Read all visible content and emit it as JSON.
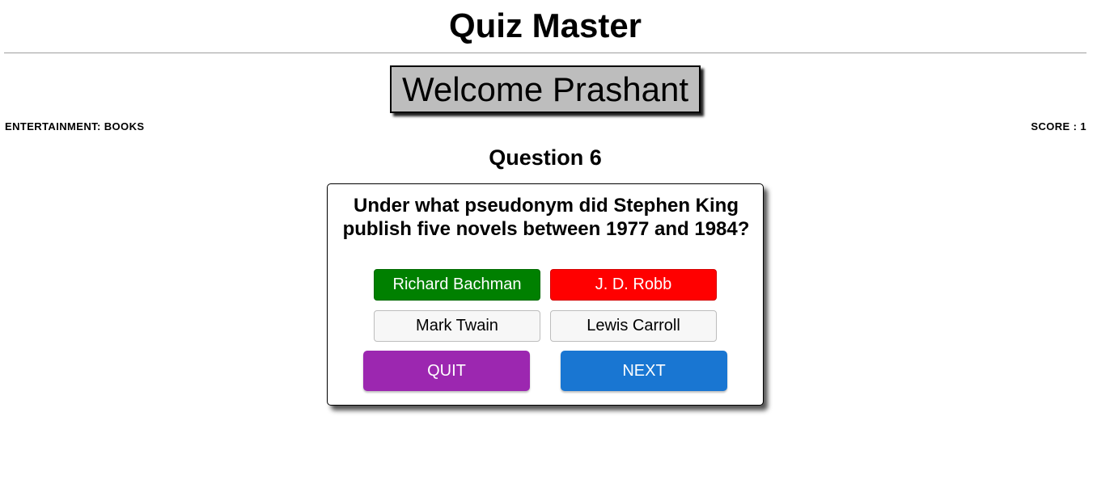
{
  "header": {
    "title": "Quiz Master"
  },
  "welcome": {
    "text": "Welcome Prashant"
  },
  "status": {
    "category": "ENTERTAINMENT: BOOKS",
    "score": "SCORE : 1"
  },
  "question": {
    "number_label": "Question 6",
    "text": "Under what pseudonym did Stephen King publish five novels between 1977 and 1984?",
    "answers": [
      {
        "label": "Richard Bachman",
        "state": "correct"
      },
      {
        "label": "J. D. Robb",
        "state": "wrong"
      },
      {
        "label": "Mark Twain",
        "state": "neutral"
      },
      {
        "label": "Lewis Carroll",
        "state": "neutral"
      }
    ]
  },
  "actions": {
    "quit_label": "QUIT",
    "next_label": "NEXT"
  },
  "colors": {
    "correct": "#008000",
    "wrong": "#ff0000",
    "quit": "#9c27b0",
    "next": "#1976d2",
    "welcome_bg": "#bdbdbd"
  }
}
